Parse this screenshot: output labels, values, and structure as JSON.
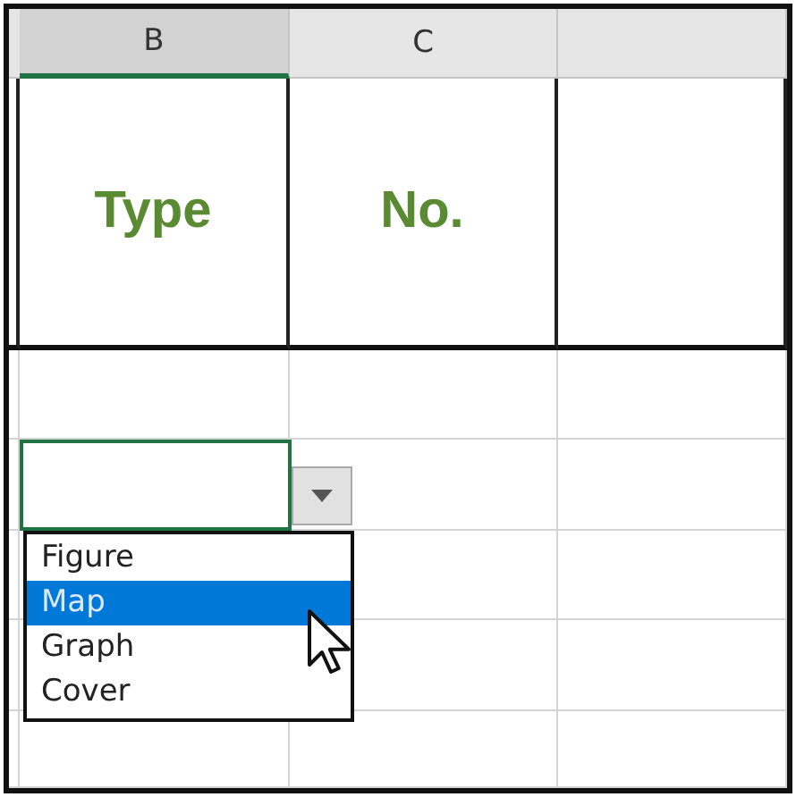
{
  "columns": [
    {
      "label": "B",
      "selected": true
    },
    {
      "label": "C",
      "selected": false
    }
  ],
  "header_row": [
    "Type",
    "No."
  ],
  "rows": [
    {
      "cells": [
        {
          "selected": false
        },
        {
          "selected": false
        },
        {
          "selected": false
        }
      ]
    },
    {
      "cells": [
        {
          "selected": true
        },
        {
          "selected": false
        },
        {
          "selected": false
        }
      ]
    },
    {
      "cells": [
        {
          "selected": false
        },
        {
          "selected": false
        },
        {
          "selected": false
        }
      ]
    },
    {
      "cells": [
        {
          "selected": false
        },
        {
          "selected": false
        },
        {
          "selected": false
        }
      ]
    },
    {
      "cells": [
        {
          "selected": false
        },
        {
          "selected": false
        },
        {
          "selected": false
        }
      ]
    }
  ],
  "dropdown": {
    "items": [
      {
        "label": "Figure",
        "selected": false
      },
      {
        "label": "Map",
        "selected": true
      },
      {
        "label": "Graph",
        "selected": false
      },
      {
        "label": "Cover",
        "selected": false
      }
    ]
  }
}
